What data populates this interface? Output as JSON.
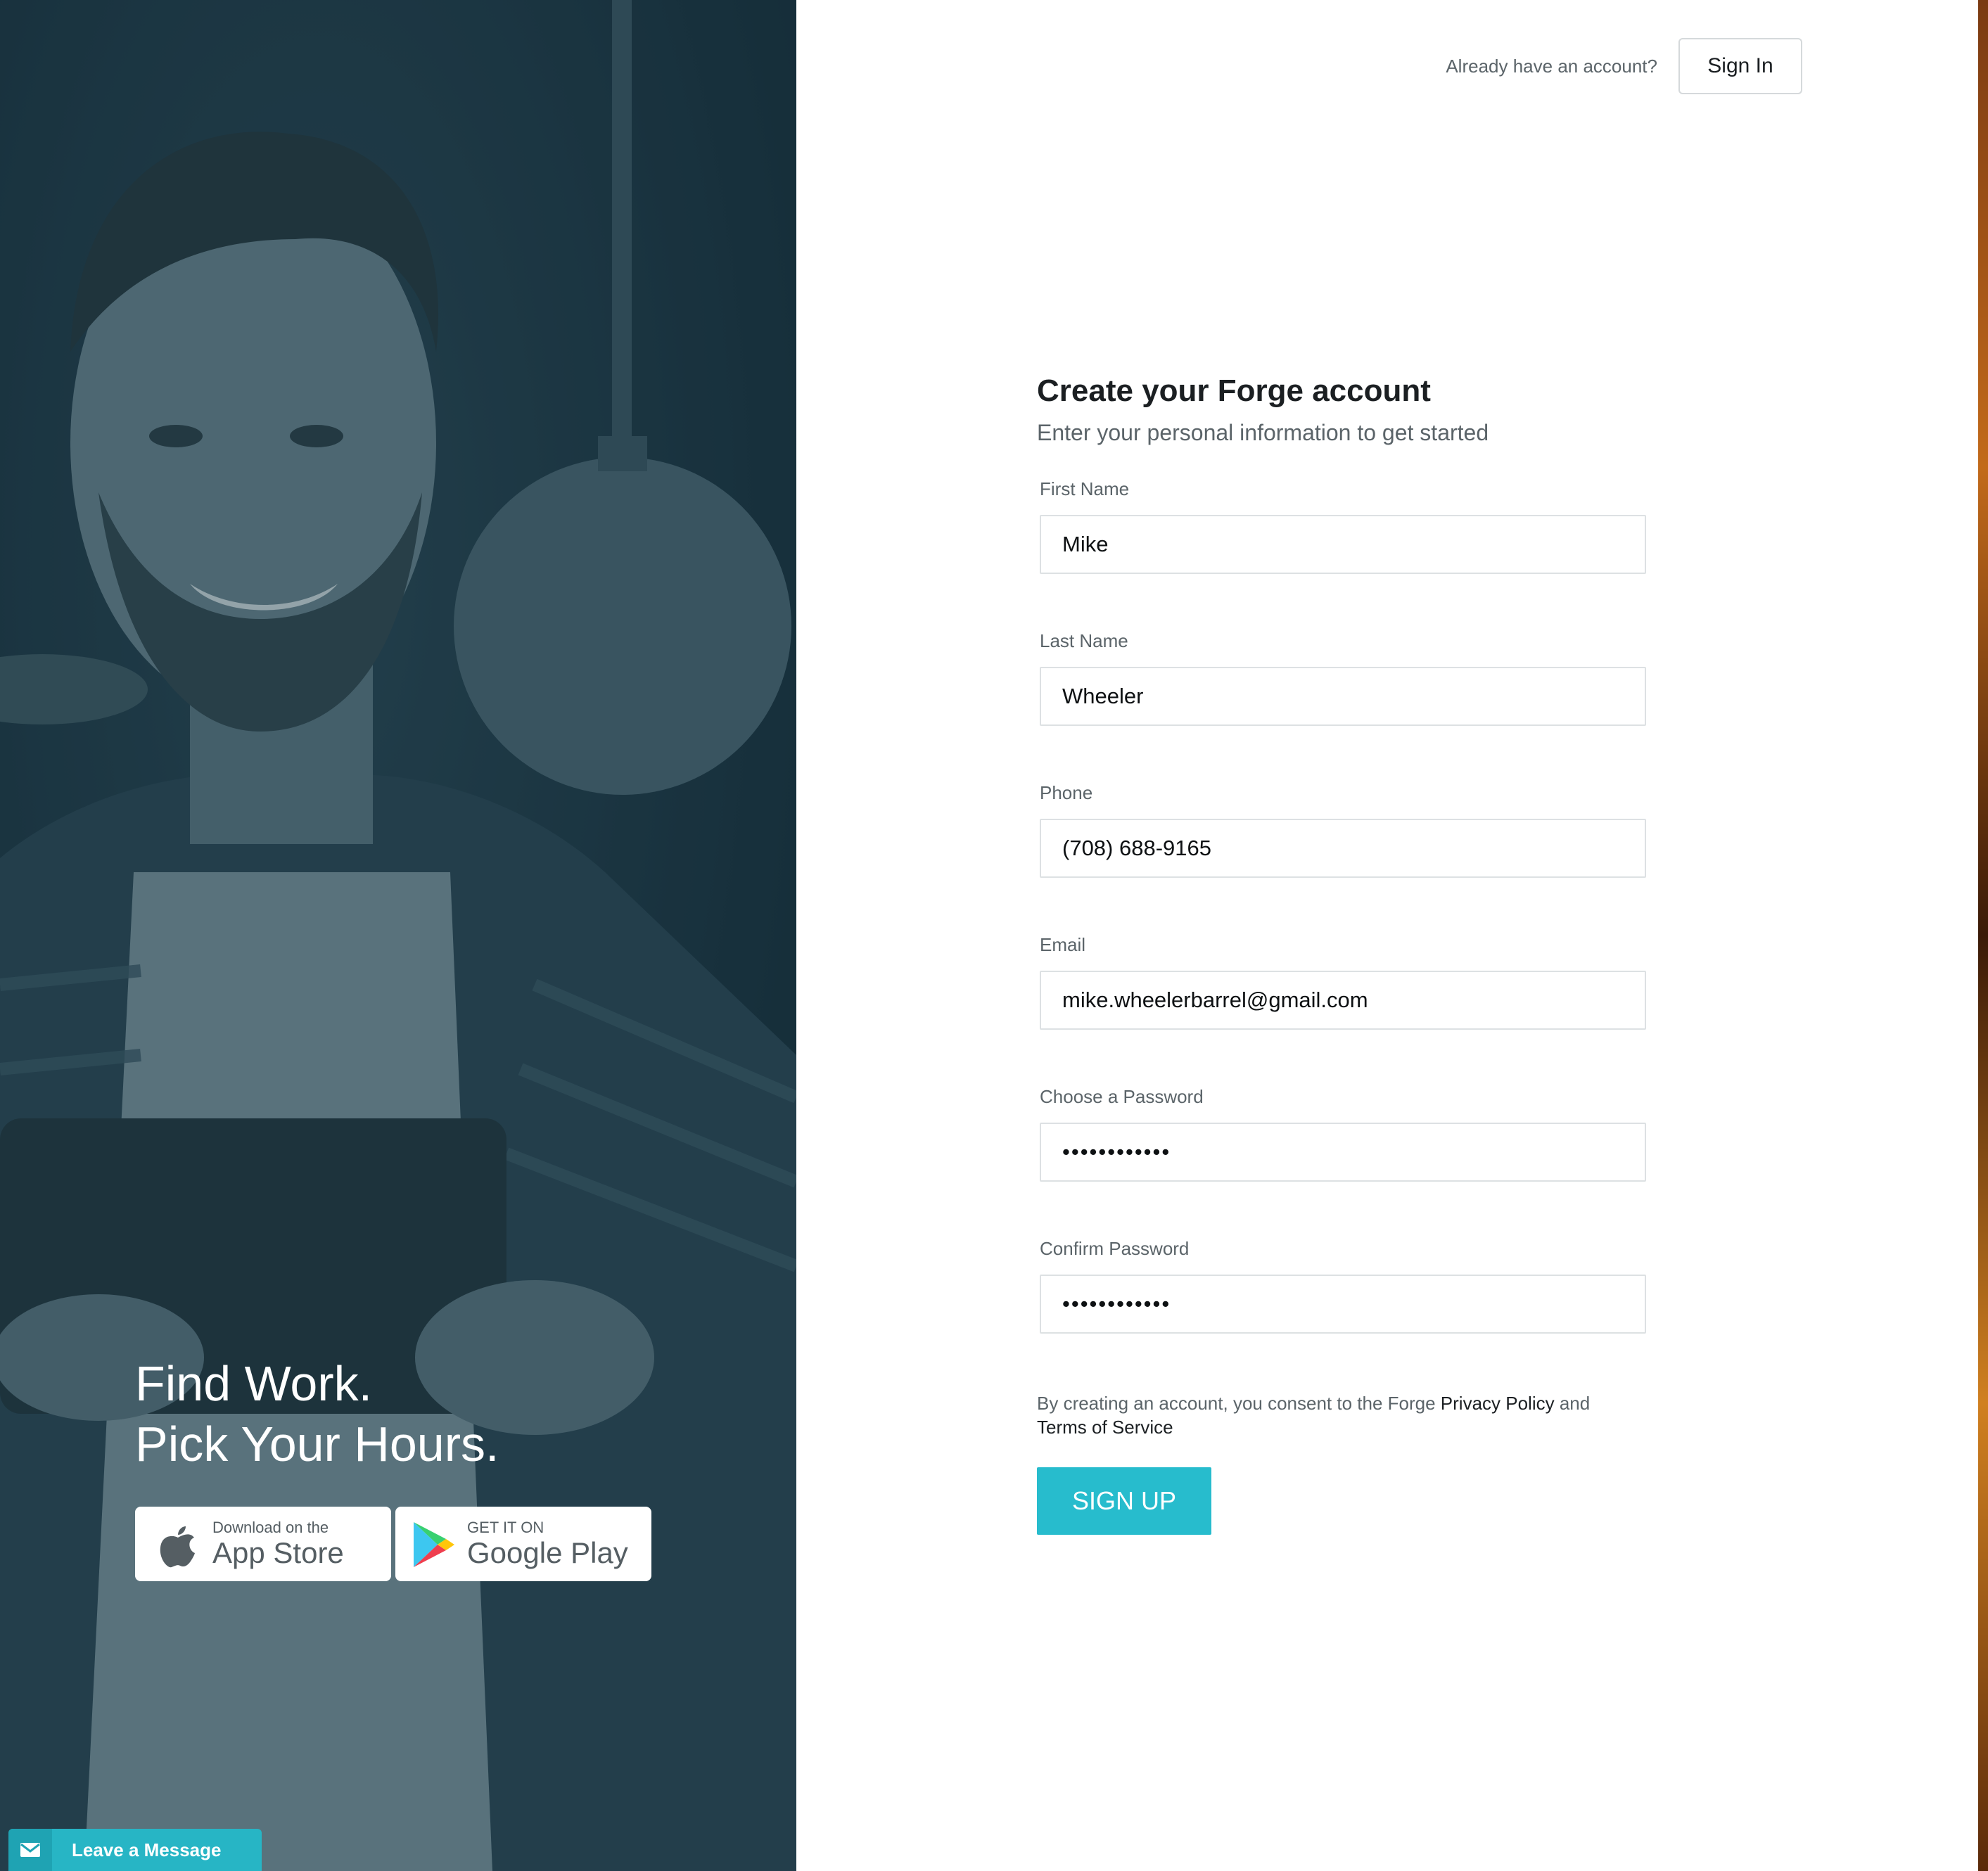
{
  "hero": {
    "tagline_line1": "Find Work.",
    "tagline_line2": "Pick Your Hours.",
    "app_store": {
      "small": "Download on the",
      "large": "App Store"
    },
    "google_play": {
      "small": "GET IT ON",
      "large": "Google Play"
    }
  },
  "header": {
    "prompt": "Already have an account?",
    "signin_label": "Sign In"
  },
  "form": {
    "title": "Create your Forge account",
    "subtitle": "Enter your personal information to get started",
    "fields": [
      {
        "label": "First Name",
        "value": "Mike"
      },
      {
        "label": "Last Name",
        "value": "Wheeler"
      },
      {
        "label": "Phone",
        "value": "(708) 688-9165"
      },
      {
        "label": "Email",
        "value": "mike.wheelerbarrel@gmail.com"
      },
      {
        "label": "Choose a Password",
        "value": "••••••••••••"
      },
      {
        "label": "Confirm Password",
        "value": "••••••••••••"
      }
    ],
    "consent_prefix": "By creating an account, you consent to the Forge ",
    "privacy_link": "Privacy Policy",
    "consent_and": " and",
    "terms_link": "Terms of Service",
    "submit_label": "SIGN UP"
  },
  "chat_widget": {
    "label": "Leave a Message",
    "icon": "envelope-icon"
  },
  "colors": {
    "accent": "#27bccd",
    "panel_overlay": "#1a3340"
  }
}
